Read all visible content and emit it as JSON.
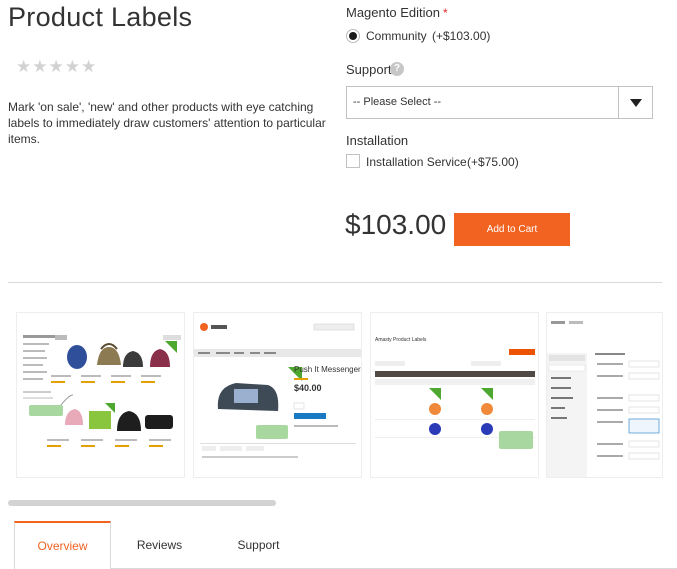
{
  "product": {
    "title": "Product Labels",
    "rating_stars": 5,
    "description": "Mark 'on sale', 'new' and other products with eye catching labels to immediately draw customers' attention to particular items."
  },
  "options": {
    "edition": {
      "label": "Magento Edition",
      "required_mark": "*",
      "choice_label": "Community",
      "choice_price": "(+$103.00)"
    },
    "support": {
      "label": "Support",
      "help_icon": "?",
      "select_value": "-- Please Select --"
    },
    "installation": {
      "label": "Installation",
      "choice_label": "Installation Service",
      "choice_price": "(+$75.00)"
    }
  },
  "price": "$103.00",
  "add_to_cart_label": "Add to Cart",
  "gallery": {
    "thumb2_title": "Push It Messenger Bag",
    "thumb2_price": "$40.00",
    "thumb3_title": "Amasty Product Labels"
  },
  "tabs": [
    {
      "label": "Overview"
    },
    {
      "label": "Reviews"
    },
    {
      "label": "Support"
    }
  ],
  "colors": {
    "accent": "#f26322",
    "label_green": "#4ea72e"
  }
}
